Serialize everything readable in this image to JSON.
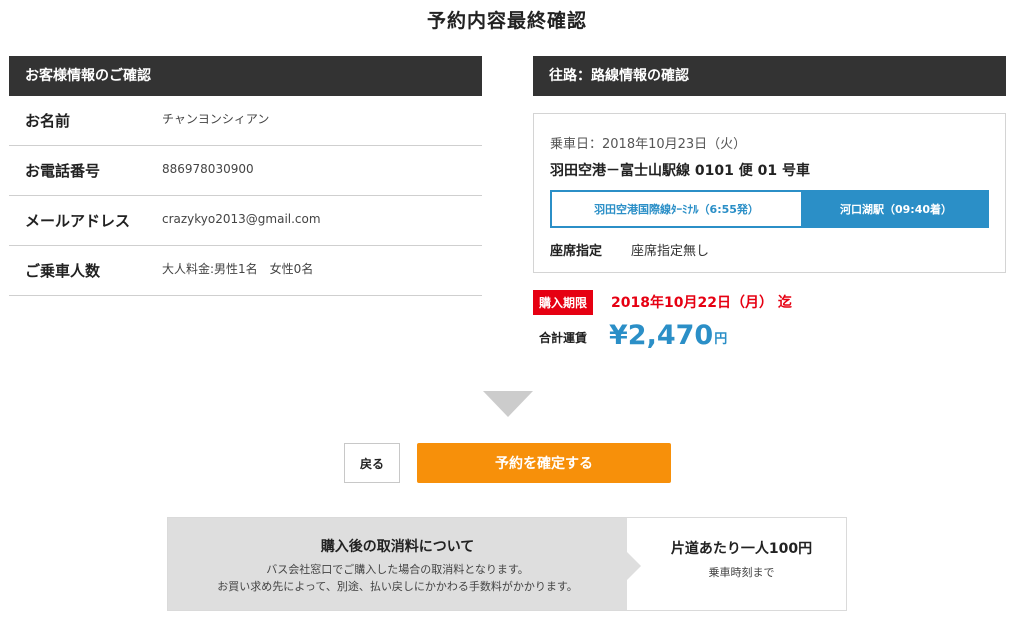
{
  "page": {
    "title": "予約内容最終確認"
  },
  "customer": {
    "header": "お客様情報のご確認",
    "rows": [
      {
        "label": "お名前",
        "value": "チャンヨンシィアン"
      },
      {
        "label": "お電話番号",
        "value": "886978030900"
      },
      {
        "label": "メールアドレス",
        "value": "crazykyo2013@gmail.com"
      },
      {
        "label": "ご乗車人数",
        "value": "大人料金:男性1名　女性0名"
      }
    ]
  },
  "route": {
    "header": "往路：路線情報の確認",
    "board_date": "乗車日：2018年10月23日（火）",
    "route_name": "羽田空港－富士山駅線 0101 便 01 号車",
    "from": "羽田空港国際線ﾀｰﾐﾅﾙ（6:55発）",
    "to": "河口湖駅（09:40着）",
    "seat_label": "座席指定",
    "seat_value": "座席指定無し"
  },
  "purchase": {
    "deadline_badge": "購入期限",
    "deadline_date": "2018年10月22日（月） 迄",
    "fare_label": "合計運賃",
    "fare_amount": "¥2,470",
    "fare_unit": "円"
  },
  "actions": {
    "back_label": "戻る",
    "confirm_label": "予約を確定する"
  },
  "cancellation": {
    "title": "購入後の取消料について",
    "desc_line1": "バス会社窓口でご購入した場合の取消料となります。",
    "desc_line2": "お買い求め先によって、別途、払い戻しにかかわる手数料がかかります。",
    "fee": "片道あたり一人100円",
    "note": "乗車時刻まで"
  },
  "colors": {
    "header_bg": "#333333",
    "accent_blue": "#2b8fc7",
    "deadline_red": "#e60012",
    "confirm_orange": "#f7900a"
  }
}
